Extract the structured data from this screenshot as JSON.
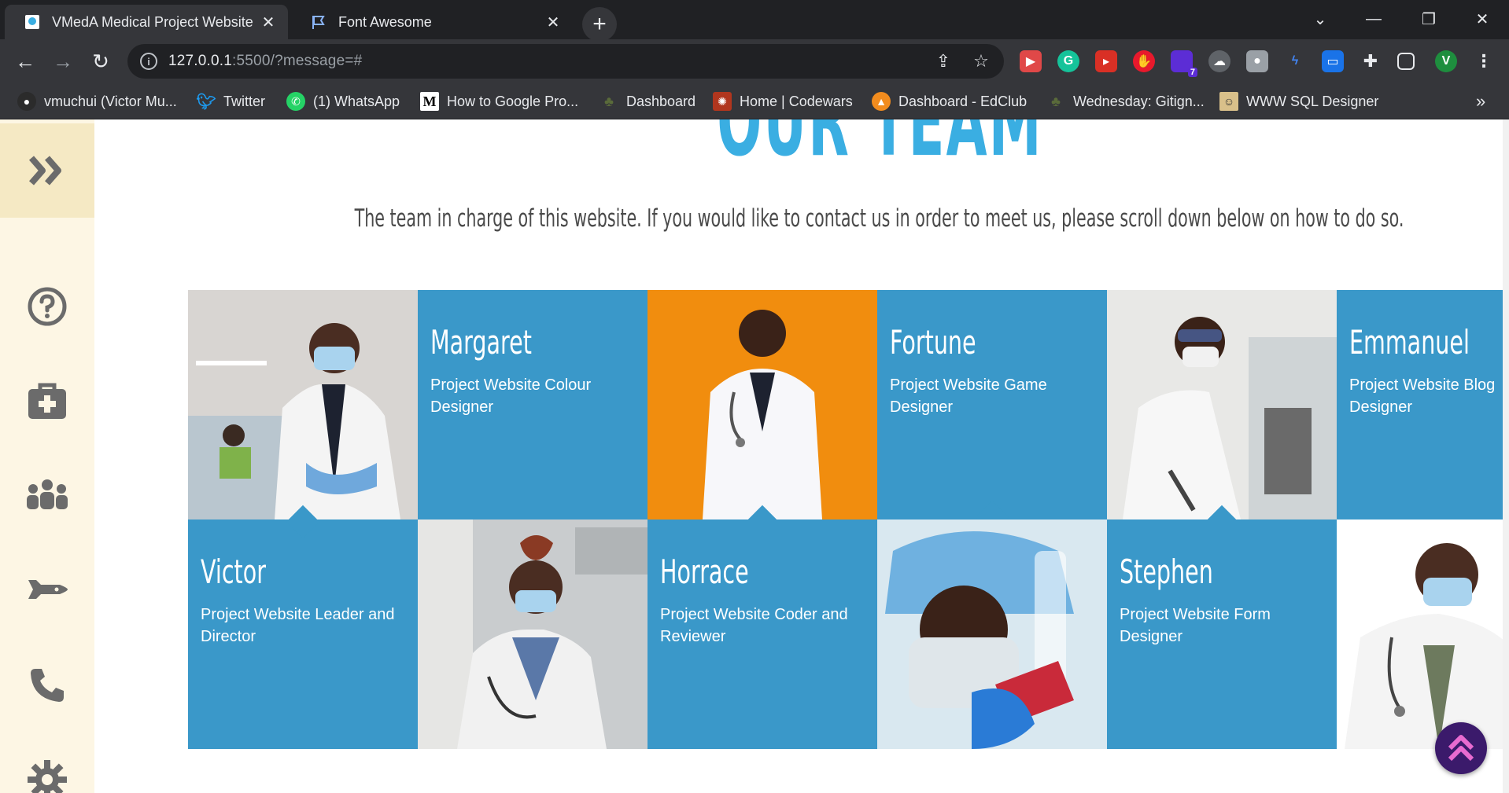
{
  "browser": {
    "tabs": [
      {
        "title": "VMedA Medical Project Website",
        "active": true
      },
      {
        "title": "Font Awesome",
        "active": false
      }
    ],
    "url_host": "127.0.0.1",
    "url_rest": ":5500/?message=#",
    "profile_initial": "V",
    "extension_badge": "7",
    "bookmarks": [
      {
        "label": "vmuchui (Victor Mu...",
        "icon": "github-icon"
      },
      {
        "label": "Twitter",
        "icon": "twitter-icon"
      },
      {
        "label": "(1) WhatsApp",
        "icon": "whatsapp-icon"
      },
      {
        "label": "How to Google Pro...",
        "icon": "medium-icon"
      },
      {
        "label": "Dashboard",
        "icon": "palm-icon"
      },
      {
        "label": "Home | Codewars",
        "icon": "codewars-icon"
      },
      {
        "label": "Dashboard - EdClub",
        "icon": "edclub-icon"
      },
      {
        "label": "Wednesday: Gitign...",
        "icon": "palm-icon"
      },
      {
        "label": "WWW SQL Designer",
        "icon": "sql-designer-icon"
      }
    ],
    "more_bookmarks": "»"
  },
  "page": {
    "heading": "OUR TEAM",
    "subtitle": "The team in charge of this website. If you would like to contact us in order to meet us, please scroll down below on how to do so.",
    "accent": "#3aaee2",
    "card_color": "#3a98c9",
    "sidebar_color": "#fdf6e4",
    "sidebar_icons": [
      "expand-icon",
      "help-icon",
      "medical-kit-icon",
      "team-icon",
      "shuttle-icon",
      "phone-icon",
      "settings-icon"
    ],
    "team": [
      {
        "name": "Victor",
        "role": "Project Website Leader and Director"
      },
      {
        "name": "Margaret",
        "role": "Project Website Colour Designer"
      },
      {
        "name": "Horrace",
        "role": "Project Website Coder and Reviewer"
      },
      {
        "name": "Fortune",
        "role": "Project Website Game Designer"
      },
      {
        "name": "Stephen",
        "role": "Project Website Form Designer"
      },
      {
        "name": "Emmanuel",
        "role": "Project Website Blog Designer"
      }
    ]
  }
}
